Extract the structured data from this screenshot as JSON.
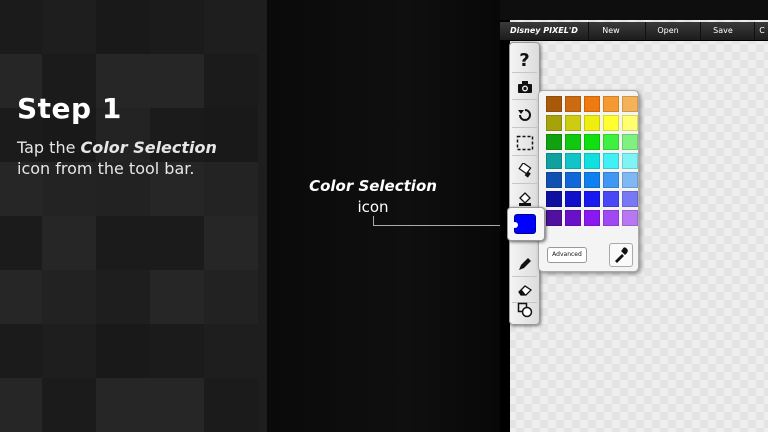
{
  "instructions": {
    "step_title": "Step 1",
    "line1_prefix": "Tap the ",
    "line1_emph": "Color Selection",
    "line2": "icon from the tool bar."
  },
  "callout": {
    "title": "Color Selection",
    "subtitle": "icon"
  },
  "app": {
    "logo": "Disney PIXEL'D",
    "menu": [
      "New",
      "Open",
      "Save",
      "C"
    ],
    "tools": [
      "help-icon",
      "camera-icon",
      "undo-icon",
      "selection-icon",
      "paint-bucket-icon",
      "color-selection-icon",
      "pencil-icon",
      "eraser-icon",
      "shapes-icon"
    ],
    "current_color": "#0000ff",
    "palette_colors": [
      [
        "#a85a0a",
        "#cc6a10",
        "#ee7a10",
        "#f49a30",
        "#f4b25a"
      ],
      [
        "#a6a20a",
        "#cccc10",
        "#eeee10",
        "#ffff30",
        "#ffff70"
      ],
      [
        "#10a010",
        "#10c810",
        "#10e010",
        "#40f040",
        "#80f080"
      ],
      [
        "#10a0a0",
        "#10c4c8",
        "#10e0e0",
        "#40f0f4",
        "#80f4f4"
      ],
      [
        "#1050b0",
        "#1068d8",
        "#1080f0",
        "#4098f4",
        "#80b8f4"
      ],
      [
        "#1010a0",
        "#1010c8",
        "#1818f0",
        "#4848f4",
        "#7878f4"
      ],
      [
        "#5010a0",
        "#6a10c8",
        "#8a18f0",
        "#a048f4",
        "#b878f4"
      ]
    ],
    "advanced_label": "Advanced"
  },
  "colors": {
    "accent_blue": "#0000ff",
    "bg_dark": "#0e0e0e"
  }
}
